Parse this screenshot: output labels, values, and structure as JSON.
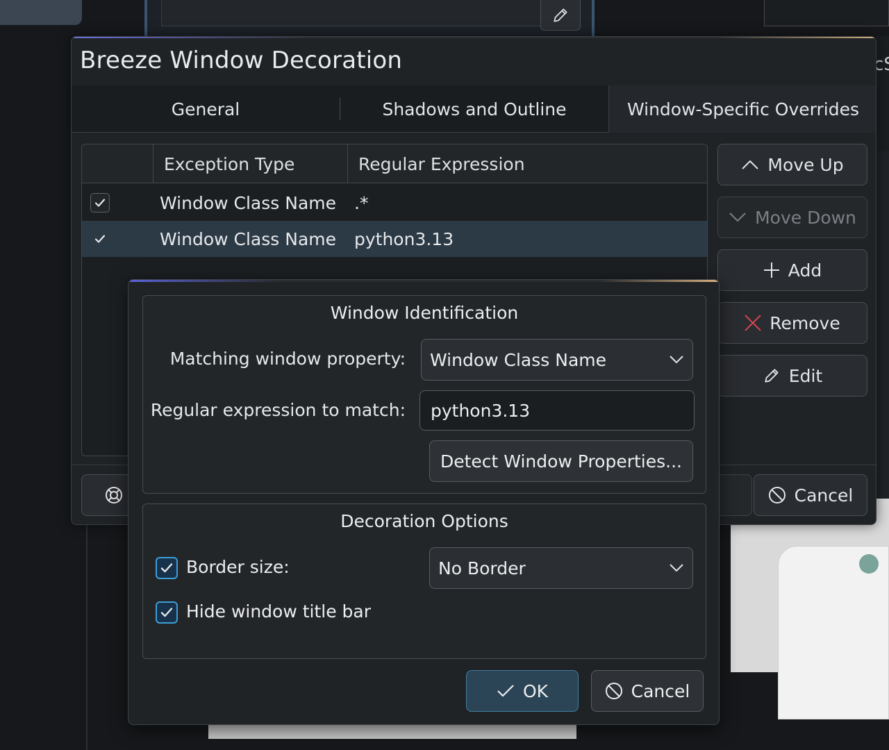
{
  "background": {
    "right_edge_text": "cS"
  },
  "window": {
    "title": "Breeze Window Decoration",
    "tabs": [
      {
        "label": "General"
      },
      {
        "label": "Shadows and Outline"
      },
      {
        "label": "Window-Specific Overrides",
        "active": true
      }
    ],
    "table": {
      "columns": [
        "",
        "Exception Type",
        "Regular Expression"
      ],
      "rows": [
        {
          "enabled": true,
          "type": "Window Class Name",
          "regex": ".*"
        },
        {
          "enabled": true,
          "type": "Window Class Name",
          "regex": "python3.13",
          "selected": true
        }
      ]
    },
    "side_buttons": {
      "move_up": "Move Up",
      "move_down": "Move Down",
      "add": "Add",
      "remove": "Remove",
      "edit": "Edit"
    },
    "footer": {
      "cancel": "Cancel"
    }
  },
  "dialog": {
    "identification": {
      "title": "Window Identification",
      "property_label": "Matching window property:",
      "property_value": "Window Class Name",
      "regex_label": "Regular expression to match:",
      "regex_value": "python3.13",
      "detect_button": "Detect Window Properties..."
    },
    "decoration": {
      "title": "Decoration Options",
      "border_size_label": "Border size:",
      "border_size_checked": true,
      "border_size_value": "No Border",
      "hide_titlebar_label": "Hide window title bar",
      "hide_titlebar_checked": true
    },
    "buttons": {
      "ok": "OK",
      "cancel": "Cancel"
    }
  },
  "colors": {
    "accent": "#3d9ed8",
    "selection": "#2c3a46",
    "remove_icon": "#d0454f"
  }
}
